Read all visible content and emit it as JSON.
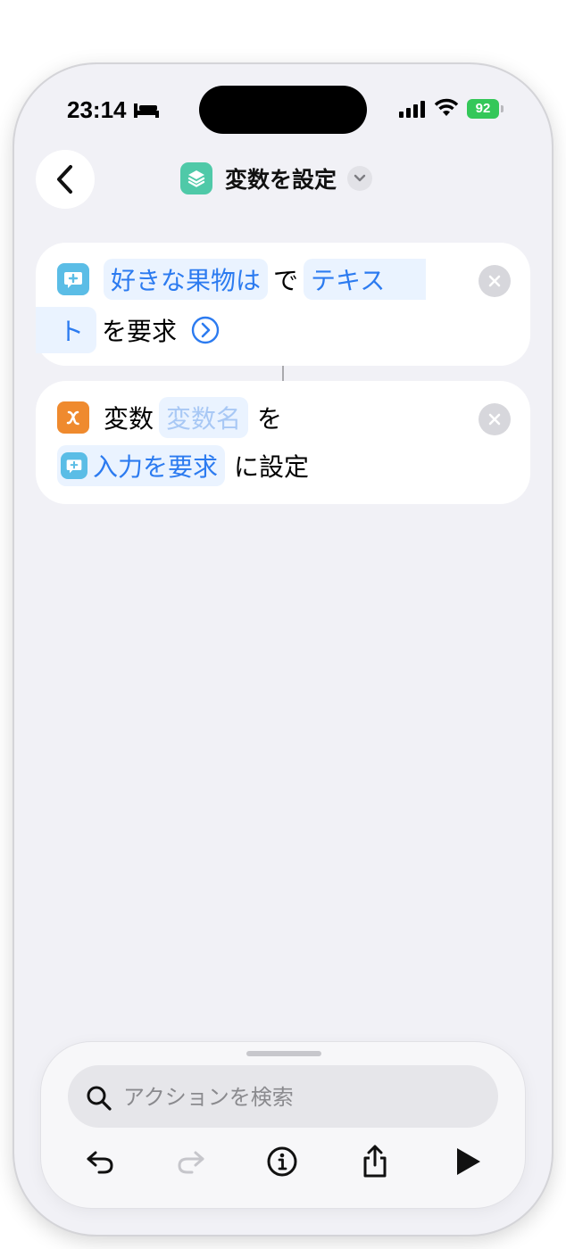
{
  "status_bar": {
    "time": "23:14",
    "battery": "92"
  },
  "nav": {
    "title": "変数を設定"
  },
  "actions": [
    {
      "token_prompt": "好きな果物は",
      "text_de": "で",
      "token_type_part1": "テキス",
      "token_type_part2": "ト",
      "text_request": "を要求"
    },
    {
      "text_variable": "変数",
      "token_var_name": "変数名",
      "text_wo": "を",
      "token_input": "入力を要求",
      "text_set": "に設定"
    }
  ],
  "search": {
    "placeholder": "アクションを検索"
  },
  "colors": {
    "token_blue": "#2c7bf0",
    "battery_green": "#34c759",
    "app_icon_green": "#4fc9a8",
    "message_icon_blue": "#5bbde6",
    "variable_icon_orange": "#ef8a2e"
  }
}
